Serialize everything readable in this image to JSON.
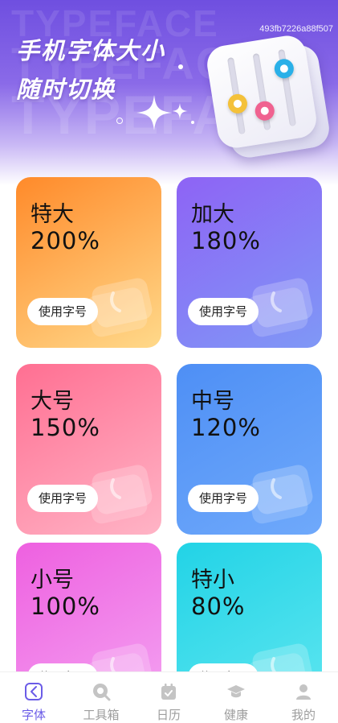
{
  "hero": {
    "title_line1": "手机字体大小",
    "title_line2": "随时切换",
    "watermark": "TYPEFACE",
    "id_text": "493fb7226a88f507"
  },
  "cards": [
    {
      "name": "特大",
      "percent": "200%",
      "button": "使用字号",
      "gradient_from": "#ff8a2a",
      "gradient_to": "#ffd98a"
    },
    {
      "name": "加大",
      "percent": "180%",
      "button": "使用字号",
      "gradient_from": "#8e63f5",
      "gradient_to": "#7f98f6"
    },
    {
      "name": "大号",
      "percent": "150%",
      "button": "使用字号",
      "gradient_from": "#ff6f92",
      "gradient_to": "#ffb4c6"
    },
    {
      "name": "中号",
      "percent": "120%",
      "button": "使用字号",
      "gradient_from": "#4e8ff5",
      "gradient_to": "#6fa9fb"
    },
    {
      "name": "小号",
      "percent": "100%",
      "button": "使用字号",
      "gradient_from": "#ee60e0",
      "gradient_to": "#f4a3f2"
    },
    {
      "name": "特小",
      "percent": "80%",
      "button": "使用字号",
      "gradient_from": "#22d3e6",
      "gradient_to": "#5ee6f0"
    }
  ],
  "tabbar": {
    "active_color": "#6b5ce7",
    "inactive_color": "#9e9e9e",
    "items": [
      {
        "label": "字体",
        "icon": "font-icon",
        "active": true
      },
      {
        "label": "工具箱",
        "icon": "toolbox-icon",
        "active": false
      },
      {
        "label": "日历",
        "icon": "calendar-icon",
        "active": false
      },
      {
        "label": "健康",
        "icon": "health-icon",
        "active": false
      },
      {
        "label": "我的",
        "icon": "profile-icon",
        "active": false
      }
    ]
  }
}
